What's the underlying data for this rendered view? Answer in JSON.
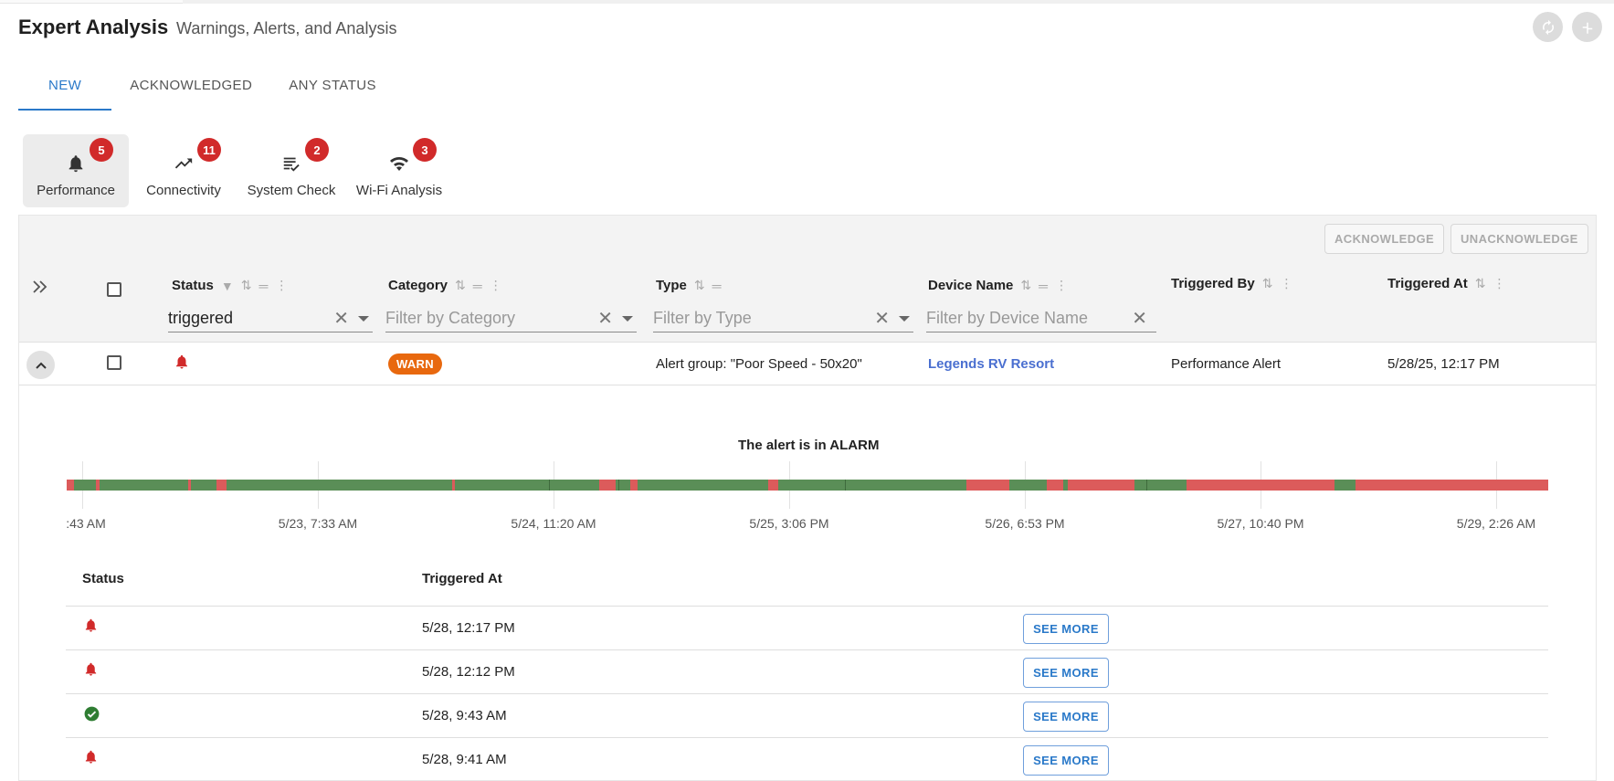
{
  "header": {
    "title": "Expert Analysis",
    "subtitle": "Warnings, Alerts, and Analysis"
  },
  "tabs": [
    {
      "label": "NEW",
      "active": true
    },
    {
      "label": "ACKNOWLEDGED",
      "active": false
    },
    {
      "label": "ANY STATUS",
      "active": false
    }
  ],
  "categories": [
    {
      "label": "Performance",
      "count": "5",
      "icon": "bell-icon",
      "selected": true
    },
    {
      "label": "Connectivity",
      "count": "11",
      "icon": "trending-up-icon",
      "selected": false
    },
    {
      "label": "System Check",
      "count": "2",
      "icon": "checklist-icon",
      "selected": false
    },
    {
      "label": "Wi-Fi Analysis",
      "count": "3",
      "icon": "wifi-icon",
      "selected": false
    }
  ],
  "actions": {
    "acknowledge": "ACKNOWLEDGE",
    "unacknowledge": "UNACKNOWLEDGE"
  },
  "columns": {
    "status": "Status",
    "category": "Category",
    "type": "Type",
    "device_name": "Device Name",
    "triggered_by": "Triggered By",
    "triggered_at": "Triggered At"
  },
  "filters": {
    "status_value": "triggered",
    "category_placeholder": "Filter by Category",
    "type_placeholder": "Filter by Type",
    "device_placeholder": "Filter by Device Name"
  },
  "row": {
    "status_icon": "bell-icon",
    "category": "WARN",
    "type": "Alert group: \"Poor Speed - 50x20\"",
    "device_name": "Legends RV Resort",
    "triggered_by": "Performance Alert",
    "triggered_at": "5/28/25, 12:17 PM"
  },
  "timeline": {
    "title": "The alert is in ALARM",
    "labels": [
      ":43 AM",
      "5/23, 7:33 AM",
      "5/24, 11:20 AM",
      "5/25, 3:06 PM",
      "5/26, 6:53 PM",
      "5/27, 10:40 PM",
      "5/29, 2:26 AM"
    ],
    "colors": {
      "ok": "#5a8e57",
      "alarm": "#dc5b5b",
      "edge": "#3f6b3d"
    },
    "segments": [
      [
        "alarm",
        0.5
      ],
      [
        "ok",
        1.5
      ],
      [
        "alarm",
        0.2
      ],
      [
        "ok",
        6.0
      ],
      [
        "alarm",
        0.2
      ],
      [
        "ok",
        1.7
      ],
      [
        "alarm",
        0.7
      ],
      [
        "ok",
        15.2
      ],
      [
        "alarm",
        0.2
      ],
      [
        "ok",
        6.3
      ],
      [
        "ok",
        3.4
      ],
      [
        "alarm",
        1.1
      ],
      [
        "ok",
        0.2
      ],
      [
        "ok",
        0.8
      ],
      [
        "alarm",
        0.5
      ],
      [
        "ok",
        8.8
      ],
      [
        "alarm",
        0.7
      ],
      [
        "ok",
        4.5
      ],
      [
        "ok",
        8.2
      ],
      [
        "alarm",
        2.9
      ],
      [
        "ok",
        2.5
      ],
      [
        "alarm",
        1.1
      ],
      [
        "ok",
        0.3
      ],
      [
        "alarm",
        4.5
      ],
      [
        "ok",
        0.8
      ],
      [
        "ok",
        2.7
      ],
      [
        "alarm",
        10.0
      ],
      [
        "ok",
        1.4
      ],
      [
        "alarm",
        13.0
      ]
    ]
  },
  "history": {
    "status_header": "Status",
    "triggered_header": "Triggered At",
    "see_more": "SEE MORE",
    "rows": [
      {
        "status": "alarm",
        "icon": "bell-icon",
        "time": "5/28, 12:17 PM"
      },
      {
        "status": "alarm",
        "icon": "bell-icon",
        "time": "5/28, 12:12 PM"
      },
      {
        "status": "ok",
        "icon": "check-circle-icon",
        "time": "5/28, 9:43 AM"
      },
      {
        "status": "alarm",
        "icon": "bell-icon",
        "time": "5/28, 9:41 AM"
      }
    ]
  }
}
